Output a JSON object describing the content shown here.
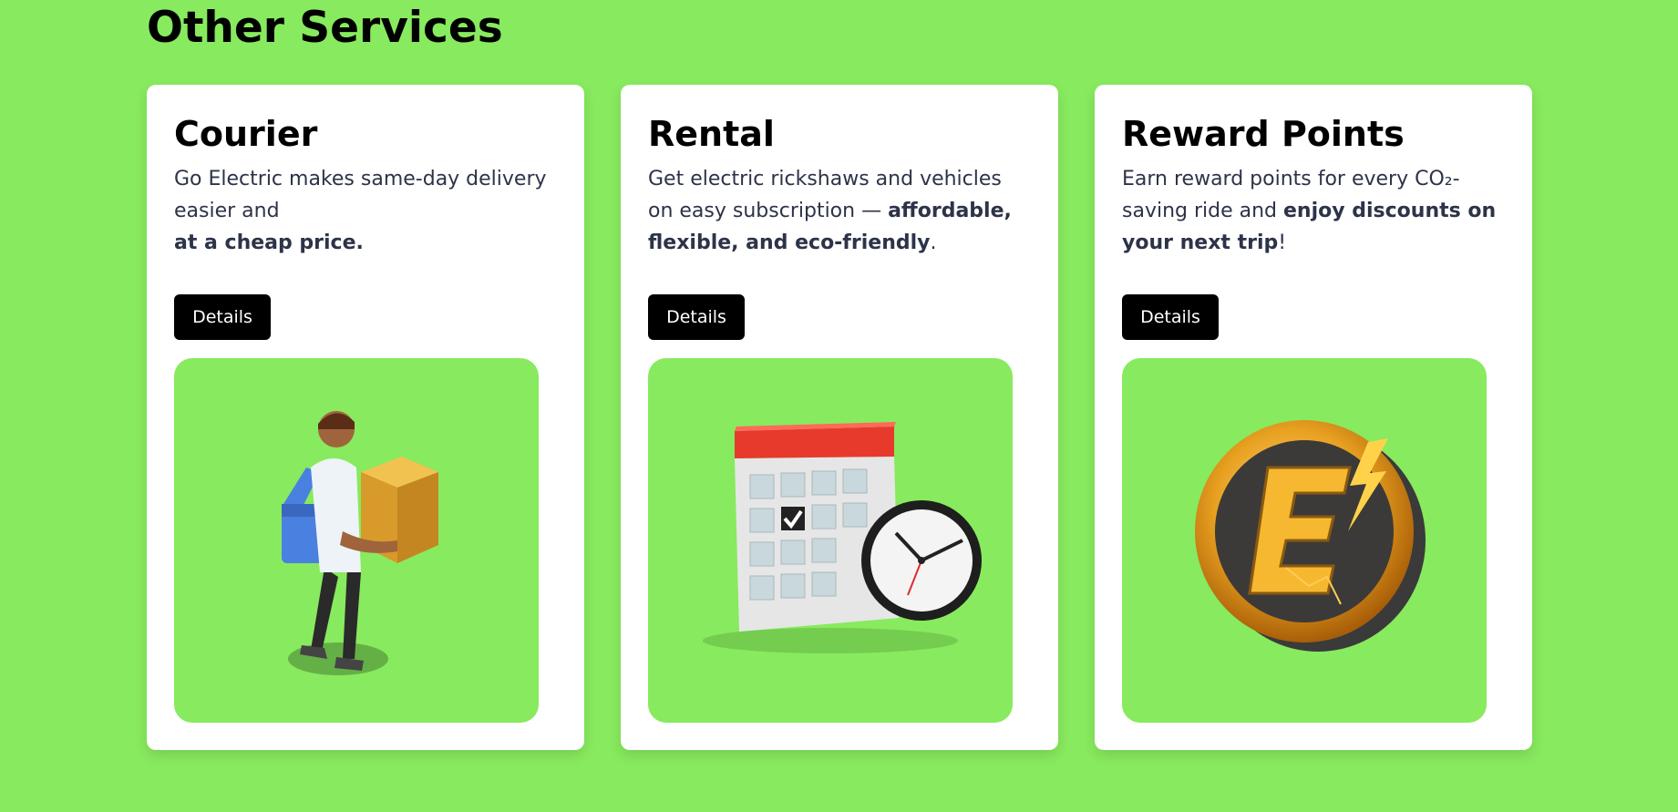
{
  "section": {
    "title": "Other Services"
  },
  "cards": [
    {
      "title": "Courier",
      "desc_plain": "Go Electric makes same-day delivery easier and",
      "desc_bold": "at a cheap price.",
      "desc_tail": "",
      "button_label": "Details",
      "illustration": "courier-person-carrying-box"
    },
    {
      "title": "Rental",
      "desc_plain": "Get electric rickshaws and vehicles on easy subscription — ",
      "desc_bold": "affordable, flexible, and eco-friendly",
      "desc_tail": ".",
      "button_label": "Details",
      "illustration": "calendar-with-clock"
    },
    {
      "title": "Reward Points",
      "desc_plain": "Earn reward points for every CO₂-saving ride and ",
      "desc_bold": "enjoy discounts on your next trip",
      "desc_tail": "!",
      "button_label": "Details",
      "illustration": "gold-e-coin-with-lightning"
    }
  ],
  "colors": {
    "background": "#88ea5e",
    "card": "#ffffff",
    "button": "#000000",
    "button_text": "#ffffff",
    "text": "#2d3348"
  }
}
